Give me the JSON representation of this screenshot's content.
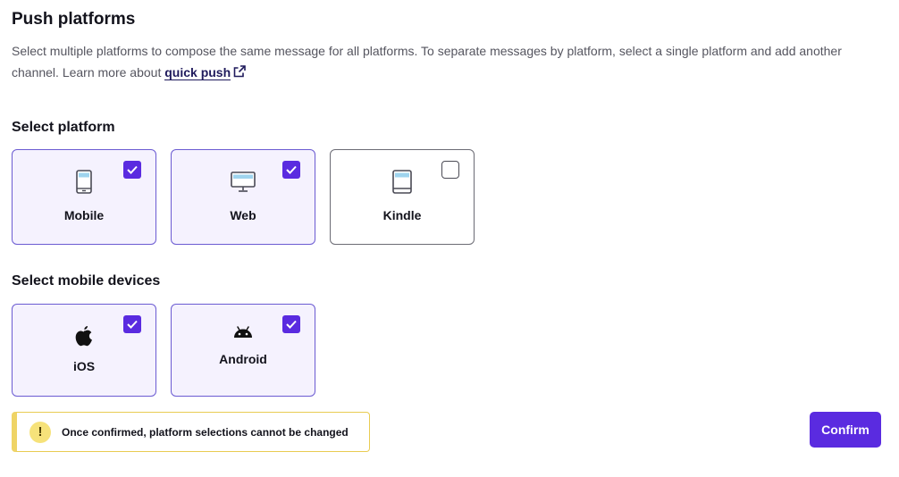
{
  "header": {
    "title": "Push platforms",
    "description_before": "Select multiple platforms to compose the same message for all platforms. To separate messages by platform, select a single platform and add another channel. Learn more about ",
    "link_label": "quick push"
  },
  "platforms": {
    "heading": "Select platform",
    "items": [
      {
        "label": "Mobile",
        "icon": "mobile-device-icon",
        "checked": true
      },
      {
        "label": "Web",
        "icon": "desktop-monitor-icon",
        "checked": true
      },
      {
        "label": "Kindle",
        "icon": "kindle-tablet-icon",
        "checked": false
      }
    ]
  },
  "devices": {
    "heading": "Select mobile devices",
    "items": [
      {
        "label": "iOS",
        "icon": "apple-icon",
        "checked": true
      },
      {
        "label": "Android",
        "icon": "android-icon",
        "checked": true
      }
    ]
  },
  "warning": {
    "icon": "!",
    "text": "Once confirmed, platform selections cannot be changed"
  },
  "actions": {
    "confirm_label": "Confirm"
  },
  "colors": {
    "accent": "#5a2be0",
    "selected_bg": "#f5f2fe",
    "warning": "#efd466"
  }
}
